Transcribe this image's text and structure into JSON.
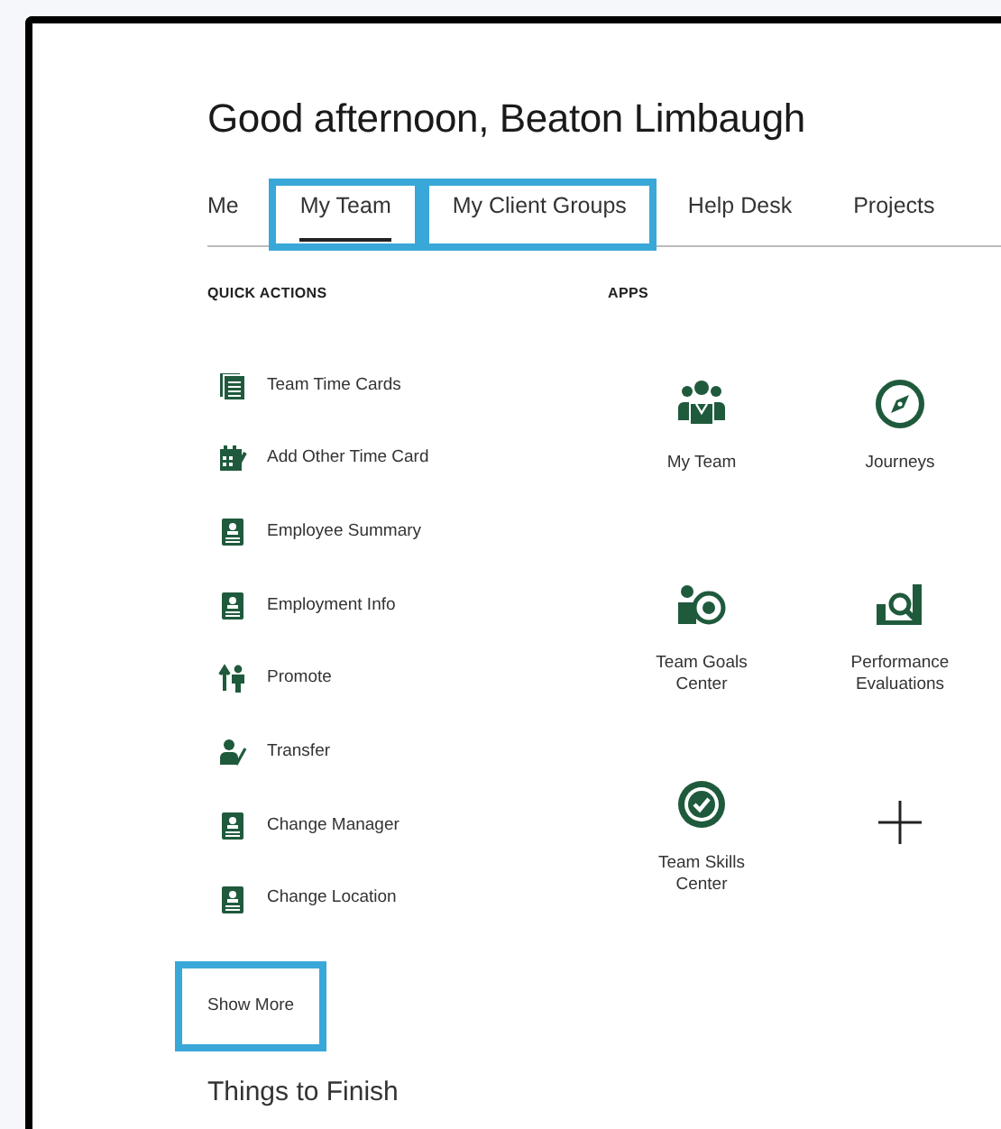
{
  "greeting": "Good afternoon, Beaton Limbaugh",
  "tabs": [
    {
      "label": "Me",
      "selected": false,
      "highlighted": false
    },
    {
      "label": "My Team",
      "selected": true,
      "highlighted": true
    },
    {
      "label": "My Client Groups",
      "selected": false,
      "highlighted": true
    },
    {
      "label": "Help Desk",
      "selected": false,
      "highlighted": false
    },
    {
      "label": "Projects",
      "selected": false,
      "highlighted": false
    }
  ],
  "quick_actions": {
    "title": "QUICK ACTIONS",
    "items": [
      {
        "label": "Team Time Cards",
        "kind": "cards"
      },
      {
        "label": "Add Other Time Card",
        "kind": "calendar"
      },
      {
        "label": "Employee Summary",
        "kind": "badge"
      },
      {
        "label": "Employment Info",
        "kind": "badge"
      },
      {
        "label": "Promote",
        "kind": "promote"
      },
      {
        "label": "Transfer",
        "kind": "transfer"
      },
      {
        "label": "Change Manager",
        "kind": "badge"
      },
      {
        "label": "Change Location",
        "kind": "badge"
      }
    ],
    "show_more": {
      "label": "Show More",
      "highlighted": true
    }
  },
  "apps": {
    "title": "APPS",
    "items": [
      {
        "label": "My Team",
        "kind": "team"
      },
      {
        "label": "Journeys",
        "kind": "compass"
      },
      {
        "label": "Team Goals Center",
        "kind": "goals"
      },
      {
        "label": "Performance Evaluations",
        "kind": "evaluation"
      },
      {
        "label": "Team Skills Center",
        "kind": "skills"
      },
      {
        "kind": "add"
      }
    ]
  },
  "things_to_finish": {
    "title": "Things to Finish"
  }
}
